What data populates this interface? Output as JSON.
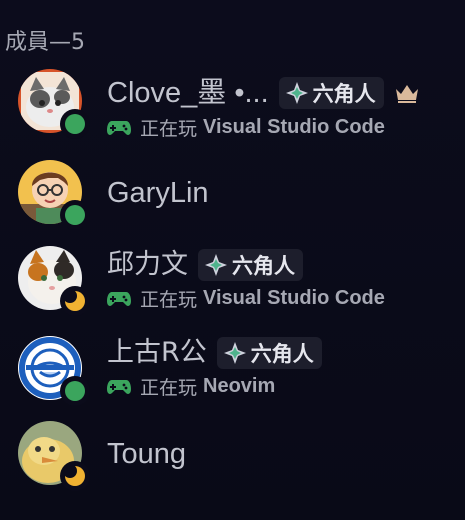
{
  "section": {
    "title": "成員—5"
  },
  "members": [
    {
      "name": "Clove_墨 •...",
      "tag": "六角人",
      "has_crown": true,
      "status": "online",
      "activity_prefix": "正在玩",
      "activity_app": "Visual Studio Code"
    },
    {
      "name": "GaryLin",
      "tag": "",
      "status": "online"
    },
    {
      "name": "邱力文",
      "tag": "六角人",
      "status": "idle",
      "activity_prefix": "正在玩",
      "activity_app": "Visual Studio Code"
    },
    {
      "name": "上古R公",
      "tag": "六角人",
      "status": "online",
      "activity_prefix": "正在玩",
      "activity_app": "Neovim"
    },
    {
      "name": "Toung",
      "tag": "",
      "status": "idle"
    }
  ],
  "colors": {
    "online": "#3ba55d",
    "idle": "#f0b232",
    "gamepad": "#3ba55d",
    "background": "#0b0b1a"
  }
}
